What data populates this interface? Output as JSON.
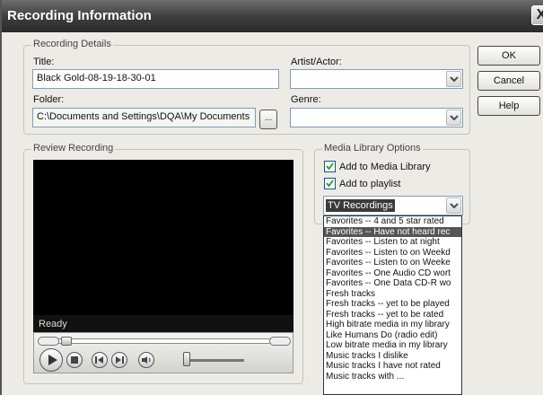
{
  "window": {
    "title": "Recording Information",
    "close_glyph": "X"
  },
  "details": {
    "group_label": "Recording Details",
    "title_label": "Title:",
    "title_value": "Black Gold-08-19-18-30-01",
    "artist_label": "Artist/Actor:",
    "artist_value": "",
    "folder_label": "Folder:",
    "folder_value": "C:\\Documents and Settings\\DQA\\My Documents",
    "browse_label": "...",
    "genre_label": "Genre:",
    "genre_value": ""
  },
  "buttons": {
    "ok": "OK",
    "cancel": "Cancel",
    "help": "Help"
  },
  "review": {
    "group_label": "Review Recording",
    "status": "Ready"
  },
  "media_library": {
    "group_label": "Media Library Options",
    "add_library_label": "Add to Media Library",
    "add_library_checked": true,
    "add_playlist_label": "Add to playlist",
    "add_playlist_checked": true,
    "playlist_selected": "TV Recordings",
    "playlist_options": [
      "Favorites -- 4 and 5 star rated",
      "Favorites -- Have not heard rec",
      "Favorites -- Listen to at night",
      "Favorites -- Listen to on Weekd",
      "Favorites -- Listen to on Weeke",
      "Favorites -- One Audio CD wort",
      "Favorites -- One Data CD-R wo",
      "Fresh tracks",
      "Fresh tracks -- yet to be played",
      "Fresh tracks -- yet to be rated",
      "High bitrate media in my library",
      "Like Humans Do (radio edit)",
      "Low bitrate media in my library",
      "Music tracks I dislike",
      "Music tracks I have not rated",
      "Music tracks with ..."
    ],
    "highlighted_index": 1
  }
}
